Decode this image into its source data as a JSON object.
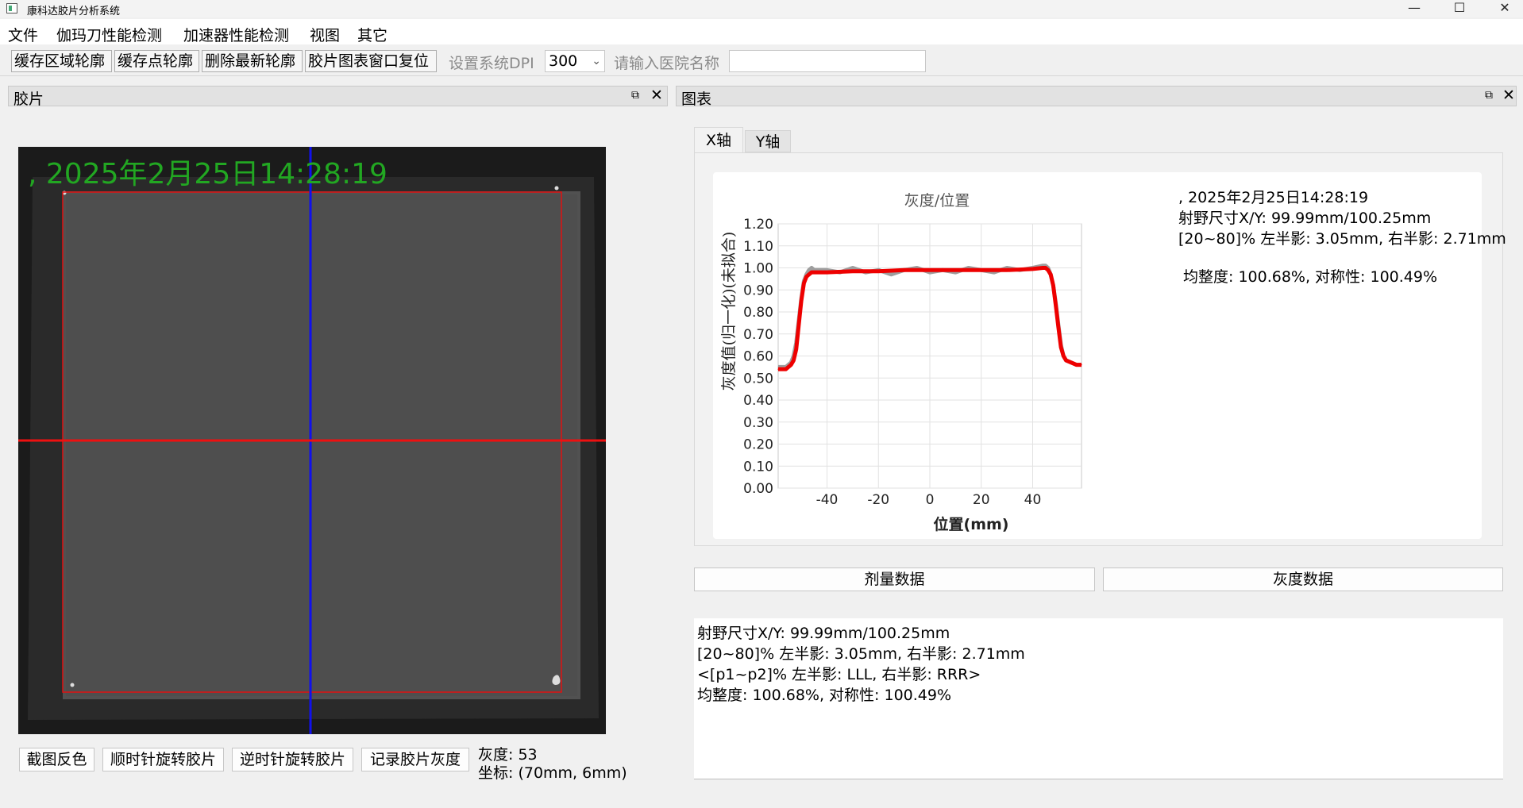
{
  "window": {
    "title": "康科达胶片分析系统",
    "minimize": "—",
    "maximize": "☐",
    "close": "✕"
  },
  "menu": [
    "文件",
    "伽玛刀性能检测",
    "加速器性能检测",
    "视图",
    "其它"
  ],
  "toolbar": {
    "buttons": [
      "缓存区域轮廓",
      "缓存点轮廓",
      "删除最新轮廓",
      "胶片图表窗口复位"
    ],
    "dpi_label": "设置系统DPI",
    "dpi_value": "300",
    "hospital_label": "请输入医院名称",
    "hospital_value": ""
  },
  "film_panel": {
    "title": "胶片",
    "float_icon": "⧉",
    "close_icon": "✕",
    "timestamp": ", 2025年2月25日14:28:19",
    "buttons": [
      "截图反色",
      "顺时针旋转胶片",
      "逆时针旋转胶片",
      "记录胶片灰度"
    ],
    "gray_label": "灰度: 53",
    "coord_label": "坐标: (70mm, 6mm)"
  },
  "chart_panel": {
    "title": "图表",
    "float_icon": "⧉",
    "close_icon": "✕",
    "tabs": [
      "X轴",
      "Y轴"
    ],
    "active_tab": "X轴",
    "info": [
      ", 2025年2月25日14:28:19",
      "射野尺寸X/Y: 99.99mm/100.25mm",
      "[20~80]% 左半影: 3.05mm, 右半影: 2.71mm",
      "均整度: 100.68%,  对称性: 100.49%"
    ],
    "buttons": [
      "剂量数据",
      "灰度数据"
    ],
    "results": [
      "射野尺寸X/Y: 99.99mm/100.25mm",
      "[20~80]% 左半影: 3.05mm, 右半影: 2.71mm",
      "<[p1~p2]% 左半影: LLL, 右半影: RRR>",
      " 均整度: 100.68%,  对称性: 100.49%"
    ]
  },
  "chart_data": {
    "type": "line",
    "title": "灰度/位置",
    "xlabel": "位置(mm)",
    "ylabel": "灰度值(归一化)(未拟合)",
    "xlim": [
      -59,
      59
    ],
    "ylim": [
      0,
      1.2
    ],
    "x_ticks": [
      -40,
      -20,
      0,
      20,
      40
    ],
    "y_ticks": [
      "0.00",
      "0.10",
      "0.20",
      "0.30",
      "0.40",
      "0.50",
      "0.60",
      "0.70",
      "0.80",
      "0.90",
      "1.00",
      "1.10",
      "1.20"
    ],
    "grid": true,
    "series": [
      {
        "color": "#9e9e9e",
        "x": [
          -59,
          -56,
          -54,
          -53,
          -52,
          -51,
          -50,
          -49,
          -48,
          -47,
          -46,
          -45,
          -40,
          -35,
          -30,
          -25,
          -20,
          -15,
          -10,
          -5,
          0,
          5,
          10,
          15,
          20,
          25,
          30,
          35,
          40,
          44,
          45,
          46,
          47,
          48,
          49,
          50,
          51,
          52,
          53,
          55,
          57,
          59
        ],
        "y": [
          0.55,
          0.55,
          0.57,
          0.6,
          0.66,
          0.76,
          0.86,
          0.94,
          0.97,
          0.99,
          1.0,
          0.99,
          0.99,
          0.98,
          1.0,
          0.98,
          0.99,
          0.97,
          0.99,
          1.0,
          0.98,
          0.99,
          0.98,
          1.0,
          0.99,
          0.98,
          1.0,
          0.99,
          1.0,
          1.01,
          1.01,
          1.0,
          0.97,
          0.92,
          0.84,
          0.74,
          0.65,
          0.6,
          0.58,
          0.57,
          0.56,
          0.56
        ]
      },
      {
        "color": "#ee0000",
        "x": [
          -59,
          -56,
          -54,
          -53,
          -52,
          -51,
          -50,
          -49,
          -48,
          -47,
          -46,
          -45,
          -40,
          -30,
          -20,
          -10,
          0,
          10,
          20,
          30,
          40,
          44,
          45,
          46,
          47,
          48,
          49,
          50,
          51,
          52,
          53,
          55,
          57,
          59
        ],
        "y": [
          0.54,
          0.54,
          0.56,
          0.58,
          0.63,
          0.74,
          0.85,
          0.93,
          0.96,
          0.97,
          0.98,
          0.98,
          0.98,
          0.985,
          0.985,
          0.99,
          0.99,
          0.99,
          0.99,
          0.99,
          0.995,
          1.0,
          1.0,
          0.99,
          0.97,
          0.92,
          0.83,
          0.73,
          0.64,
          0.6,
          0.58,
          0.57,
          0.56,
          0.56
        ]
      }
    ]
  },
  "film_image": {
    "colors": {
      "film_bg": "#1b1b1b",
      "field": "#4e4e4e",
      "contour": "#e01010",
      "v_line": "#1010ee",
      "h_line": "#ee1010"
    }
  }
}
